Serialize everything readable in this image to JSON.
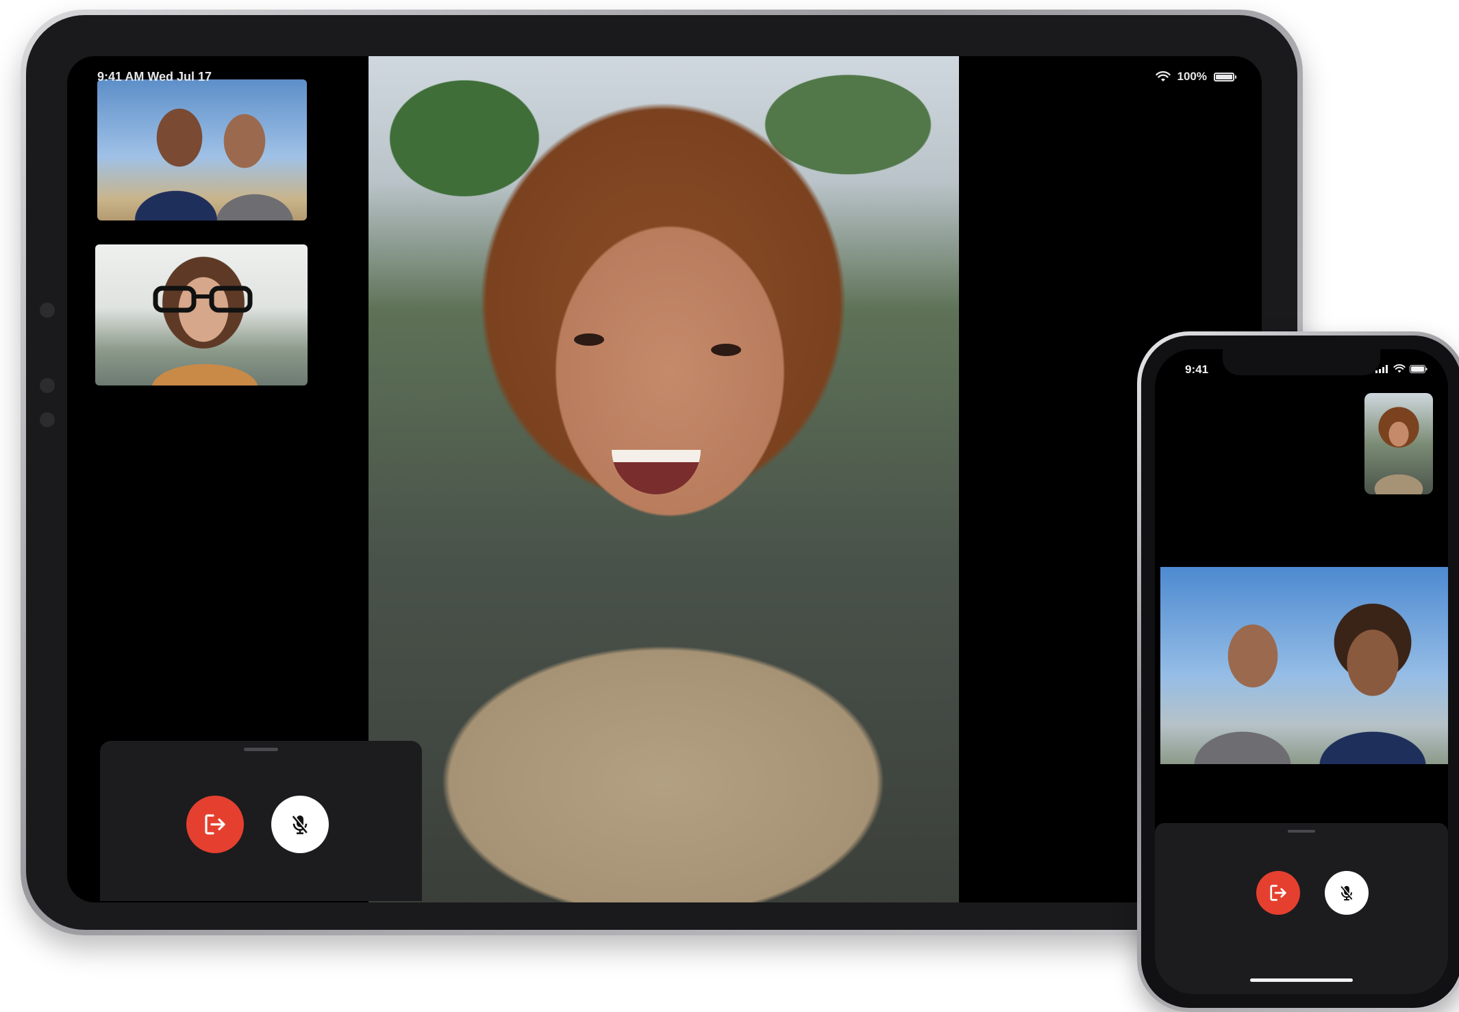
{
  "ipad": {
    "status_bar": {
      "time_date": "9:41 AM  Wed Jul 17",
      "battery_percent": "100%",
      "wifi_icon": "wifi-icon",
      "battery_icon": "battery-icon"
    },
    "participants": [
      {
        "tile": "couple-video-tile"
      },
      {
        "tile": "woman-glasses-video-tile"
      }
    ],
    "main_video": "featured-participant-video",
    "controls": {
      "leave_icon": "leave-call-icon",
      "mute_icon": "mic-mute-icon"
    }
  },
  "iphone": {
    "status_bar": {
      "time": "9:41",
      "signal_icon": "cellular-signal-icon",
      "wifi_icon": "wifi-icon",
      "battery_icon": "battery-icon"
    },
    "self_view": "self-view-tile",
    "remote_video": "couple-video-tile",
    "controls": {
      "leave_icon": "leave-call-icon",
      "mute_icon": "mic-mute-icon"
    }
  },
  "colors": {
    "end_call": "#e5402f",
    "mute_button": "#ffffff",
    "sheet_background": "#1c1c1e",
    "screen_background": "#000000"
  }
}
